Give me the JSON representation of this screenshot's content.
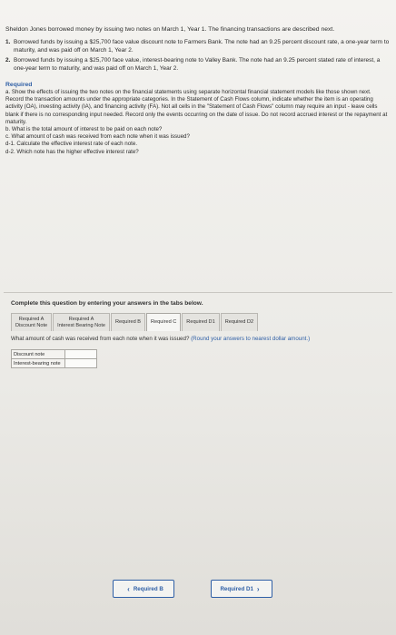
{
  "intro": "Sheldon Jones borrowed money by issuing two notes on March 1, Year 1. The financing transactions are described next.",
  "items": [
    {
      "num": "1.",
      "text": "Borrowed funds by issuing a $25,700 face value discount note to Farmers Bank. The note had an 9.25 percent discount rate, a one-year term to maturity, and was paid off on March 1, Year 2."
    },
    {
      "num": "2.",
      "text": "Borrowed funds by issuing a $25,700 face value, interest-bearing note to Valley Bank. The note had an 9.25 percent stated rate of interest, a one-year term to maturity, and was paid off on March 1, Year 2."
    }
  ],
  "required": {
    "title": "Required",
    "a": "a. Show the effects of issuing the two notes on the financial statements using separate horizontal financial statement models like those shown next. Record the transaction amounts under the appropriate categories. In the Statement of Cash Flows column, indicate whether the item is an operating activity (OA), investing activity (IA), and financing activity (FA). Not all cells in the \"Statement of Cash Flows\" column may require an input - leave cells blank if there is no corresponding input needed. Record only the events occurring on the date of issue. Do not record accrued interest or the repayment at maturity.",
    "b": "b. What is the total amount of interest to be paid on each note?",
    "c": "c. What amount of cash was received from each note when it was issued?",
    "d1": "d-1. Calculate the effective interest rate of each note.",
    "d2": "d-2. Which note has the higher effective interest rate?"
  },
  "panel": {
    "complete": "Complete this question by entering your answers in the tabs below.",
    "tabs": [
      {
        "line1": "Required A",
        "line2": "Discount Note"
      },
      {
        "line1": "Required A",
        "line2": "Interest Bearing Note"
      },
      {
        "line1": "Required B",
        "line2": ""
      },
      {
        "line1": "Required C",
        "line2": ""
      },
      {
        "line1": "Required D1",
        "line2": ""
      },
      {
        "line1": "Required D2",
        "line2": ""
      }
    ],
    "question": "What amount of cash was received from each note when it was issued?",
    "hint": "(Round your answers to nearest dollar amount.)",
    "rows": [
      {
        "label": "Discount note",
        "value": ""
      },
      {
        "label": "Interest-bearing note",
        "value": ""
      }
    ],
    "prev_label": "Required B",
    "next_label": "Required D1"
  }
}
